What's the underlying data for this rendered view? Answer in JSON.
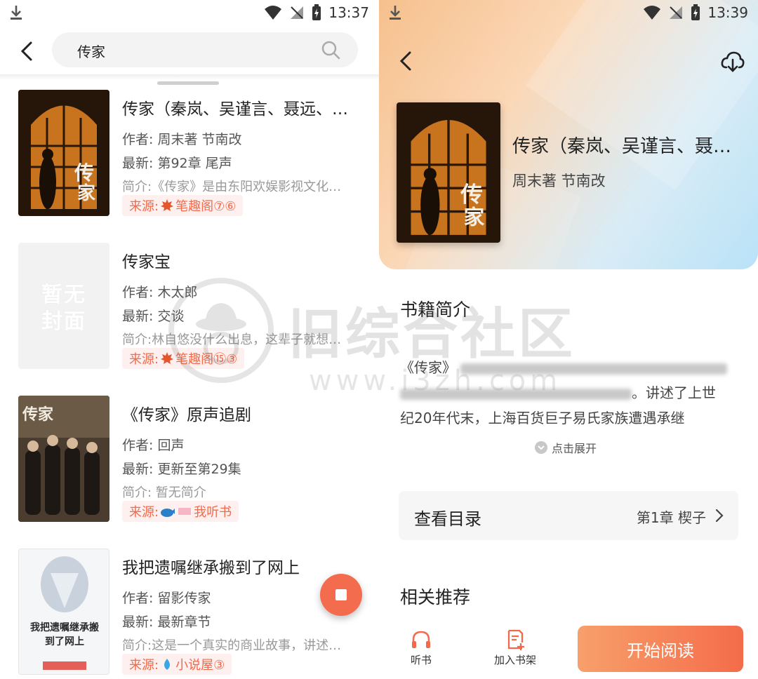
{
  "left_panel": {
    "status": {
      "time": "13:37"
    },
    "search": {
      "query": "传家"
    },
    "books": [
      {
        "title": "传家（秦岚、吴谨言、聂远、…",
        "author": "作者: 周末著 节南改",
        "latest": "最新: 第92章 尾声",
        "intro": "简介:《传家》是由东阳欢娱影视文化…",
        "source": "来源:",
        "source_name": "笔趣阁⑦⑥",
        "cover_type": "poster"
      },
      {
        "title": "传家宝",
        "author": "作者: 木太郎",
        "latest": "最新: 交谈",
        "intro": "简介:林自悠没什么出息，这辈子就想…",
        "source": "来源:",
        "source_name": "笔趣阁⑮③",
        "cover_type": "placeholder",
        "cover_text": "暂无封面"
      },
      {
        "title": "《传家》原声追剧",
        "author": "作者: 回声",
        "latest": "最新: 更新至第29集",
        "intro": "简介: 暂无简介",
        "source": "来源:",
        "source_name": "我听书",
        "cover_type": "drama"
      },
      {
        "title": "我把遗嘱继承搬到了网上",
        "author": "作者: 留影传家",
        "latest": "最新: 最新章节",
        "intro": "简介:这是一个真实的商业故事，讲述…",
        "source": "来源:",
        "source_name": "小说屋③",
        "cover_type": "novel",
        "cover_text": "我把遗嘱继承搬到了网上"
      }
    ]
  },
  "right_panel": {
    "status": {
      "time": "13:39"
    },
    "book": {
      "title": "传家（秦岚、吴谨言、聂…",
      "author": "周末著 节南改"
    },
    "intro_section": {
      "heading": "书籍简介",
      "line1": "《传家》",
      "line2_visible": "。讲述了上世",
      "line3": "纪20年代末，上海百货巨子易氏家族遭遇承继",
      "expand_label": "点击展开"
    },
    "toc": {
      "label": "查看目录",
      "chapter": "第1章 楔子"
    },
    "related": {
      "heading": "相关推荐"
    },
    "bottom_bar": {
      "listen_label": "听书",
      "shelf_label": "加入书架",
      "read_label": "开始阅读"
    }
  },
  "watermark": {
    "text": "旧综合社区",
    "url": "www.i3zh.com"
  },
  "colors": {
    "accent": "#f46c4e",
    "source_tag_bg": "#fdf0ee",
    "source_tag_text": "#f26a4b",
    "hero_warm": "#f6c08d",
    "hero_cool": "#b9e2f7"
  }
}
